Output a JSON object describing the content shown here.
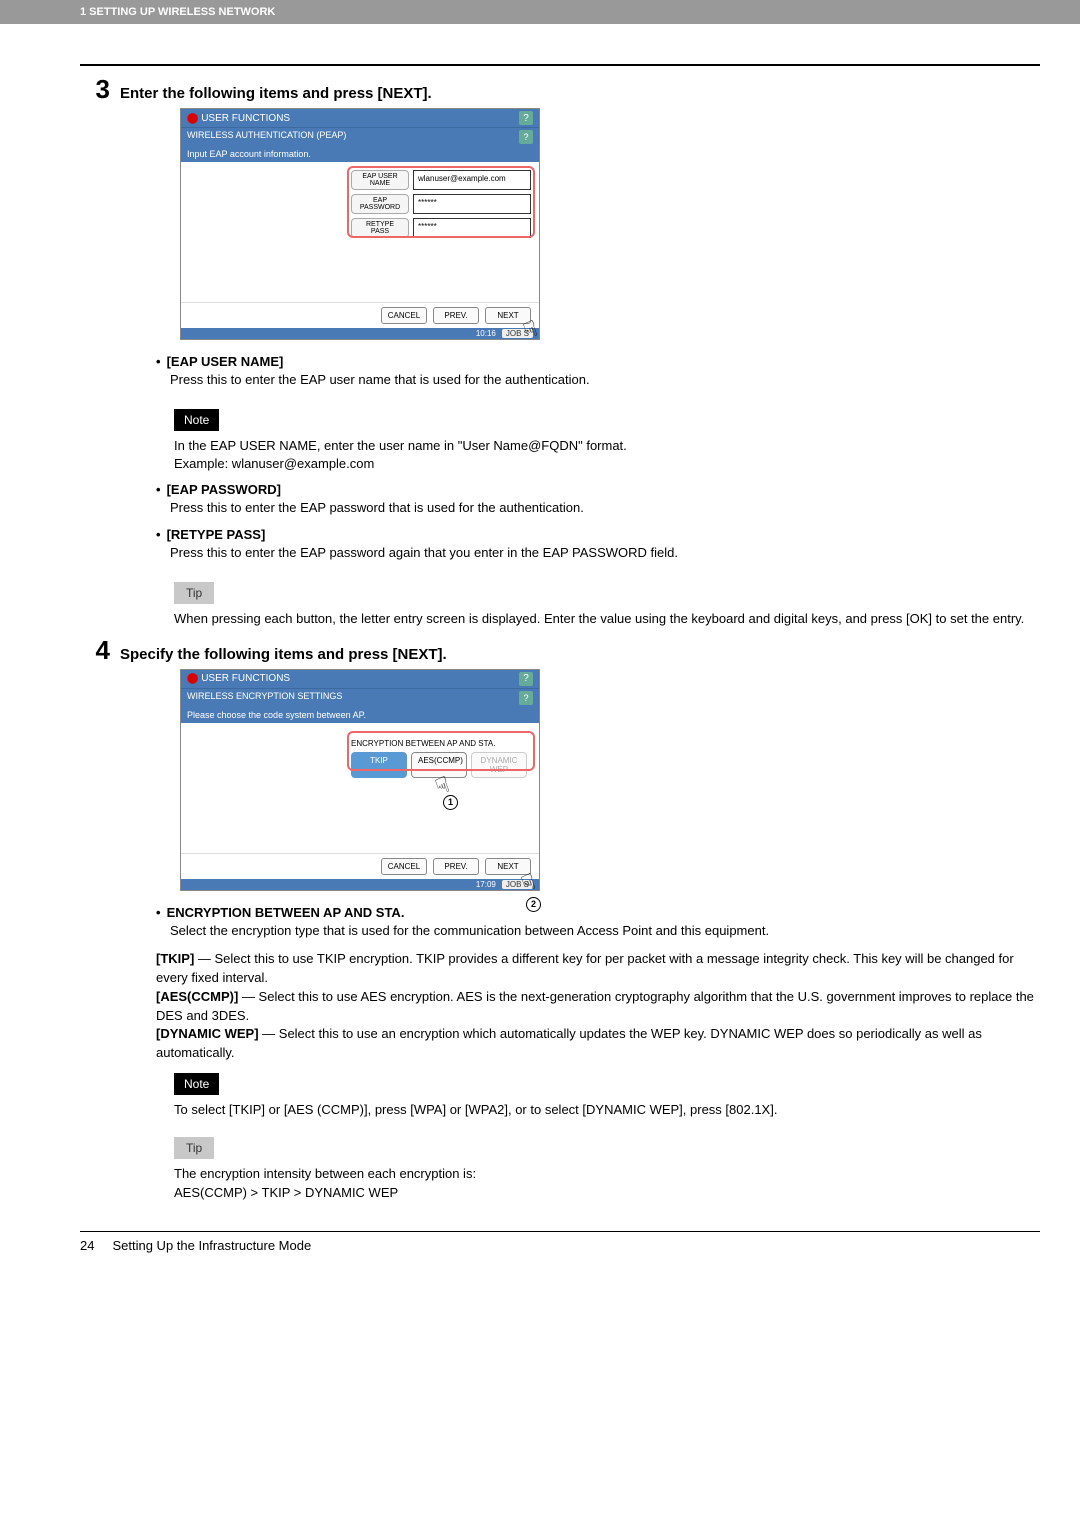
{
  "header_bar": "1 SETTING UP WIRELESS NETWORK",
  "step3": {
    "num": "3",
    "title": "Enter the following items and press [NEXT].",
    "ss": {
      "title": "USER FUNCTIONS",
      "sub": "WIRELESS AUTHENTICATION (PEAP)",
      "prompt": "Input EAP account information.",
      "fields": {
        "user_label": "EAP USER\nNAME",
        "user_val": "wlanuser@example.com",
        "pass_label": "EAP\nPASSWORD",
        "pass_val": "******",
        "retype_label": "RETYPE PASS",
        "retype_val": "******"
      },
      "cancel": "CANCEL",
      "prev": "PREV.",
      "next": "NEXT",
      "time": "10:16",
      "job": "JOB S"
    },
    "bullets": {
      "b1_name": "[EAP USER NAME]",
      "b1_desc": "Press this to enter the EAP user name that is used for the authentication.",
      "note_label": "Note",
      "note_text": "In the EAP USER NAME, enter the user name in \"User Name@FQDN\" format.\nExample: wlanuser@example.com",
      "b2_name": "[EAP PASSWORD]",
      "b2_desc": "Press this to enter the EAP password that is used for the authentication.",
      "b3_name": "[RETYPE PASS]",
      "b3_desc": "Press this to enter the EAP password again that you enter in the EAP PASSWORD field.",
      "tip_label": "Tip",
      "tip_text": "When pressing each button, the letter entry screen is displayed. Enter the value using the keyboard and digital keys, and press [OK] to set the entry."
    }
  },
  "step4": {
    "num": "4",
    "title": "Specify the following items and press [NEXT].",
    "ss": {
      "title": "USER FUNCTIONS",
      "sub": "WIRELESS ENCRYPTION SETTINGS",
      "prompt": "Please choose the code system between AP.",
      "enc_label": "ENCRYPTION BETWEEN AP AND STA.",
      "opt1": "TKIP",
      "opt2": "AES(CCMP)",
      "opt3": "DYNAMIC WEP",
      "cancel": "CANCEL",
      "prev": "PREV.",
      "next": "NEXT",
      "time": "17:09",
      "job": "JOB S",
      "badge1": "1",
      "badge2": "2"
    },
    "bullets": {
      "b1_name": "ENCRYPTION BETWEEN AP AND STA.",
      "b1_desc": "Select the encryption type that is used for the communication between Access Point and this equipment.",
      "tkip_l": "[TKIP]",
      "tkip_d": " — Select this to use TKIP encryption. TKIP provides a different key for per packet with a message integrity check.  This key will be changed for every fixed interval.",
      "aes_l": "[AES(CCMP)]",
      "aes_d": " — Select this to use AES encryption. AES is the next-generation cryptography algorithm that the U.S. government improves to replace the DES and 3DES.",
      "dw_l": "[DYNAMIC WEP]",
      "dw_d": " — Select this to use an encryption which automatically updates the WEP key. DYNAMIC WEP does so periodically as well as automatically.",
      "note_label": "Note",
      "note_text": "To select [TKIP] or [AES (CCMP)], press [WPA] or [WPA2], or to select [DYNAMIC WEP], press [802.1X].",
      "tip_label": "Tip",
      "tip_text": "The encryption intensity between each encryption is:\nAES(CCMP) > TKIP > DYNAMIC WEP"
    }
  },
  "footer": {
    "page": "24",
    "title": "Setting Up the Infrastructure Mode"
  },
  "help_q": "?"
}
